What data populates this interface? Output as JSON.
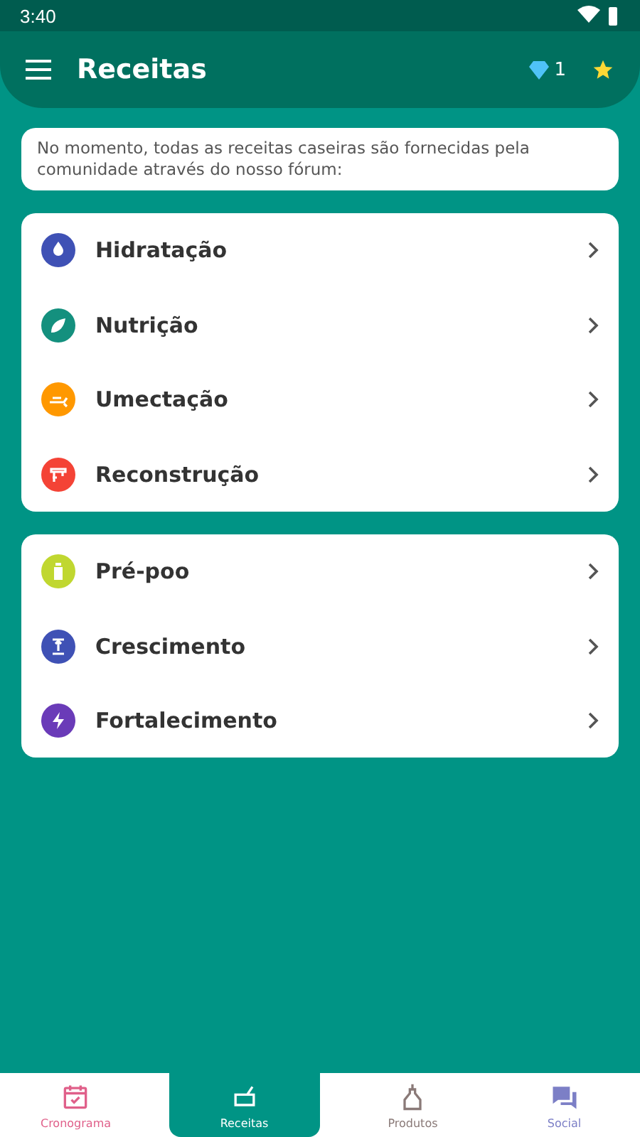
{
  "status_bar": {
    "time": "3:40"
  },
  "app_bar": {
    "title": "Receitas",
    "gems": "1"
  },
  "notice": "No momento, todas as receitas caseiras são fornecidas pela comunidade através do nosso fórum:",
  "groups": [
    {
      "items": [
        {
          "label": "Hidratação",
          "color": "#3f51b5"
        },
        {
          "label": "Nutrição",
          "color": "#14907e"
        },
        {
          "label": "Umectação",
          "color": "#ff9800"
        },
        {
          "label": "Reconstrução",
          "color": "#f44336"
        }
      ]
    },
    {
      "items": [
        {
          "label": "Pré-poo",
          "color": "#c0d730"
        },
        {
          "label": "Crescimento",
          "color": "#3f51b5"
        },
        {
          "label": "Fortalecimento",
          "color": "#6a3bb8"
        }
      ]
    }
  ],
  "nav": [
    {
      "label": "Cronograma",
      "selected": false,
      "color": "#e0608a"
    },
    {
      "label": "Receitas",
      "selected": true,
      "color": "#ffffff"
    },
    {
      "label": "Produtos",
      "selected": false,
      "color": "#8a7a78"
    },
    {
      "label": "Social",
      "selected": false,
      "color": "#7c7fc6"
    }
  ]
}
